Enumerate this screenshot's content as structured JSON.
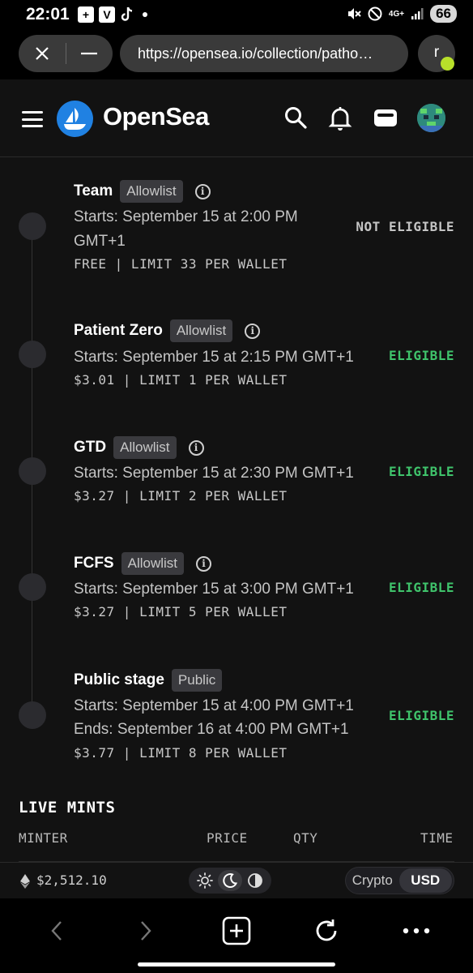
{
  "status_bar": {
    "time": "22:01",
    "network": "4G+",
    "battery": "66",
    "icons": [
      "plus-box-icon",
      "v-app-icon",
      "tiktok-icon",
      "notification-dot",
      "mute-icon",
      "dnd-icon",
      "signal-icon",
      "battery-icon"
    ]
  },
  "browser": {
    "url": "https://opensea.io/collection/patho…",
    "profile_initial": "r"
  },
  "header": {
    "brand": "OpenSea",
    "brand_color": "#2081e2"
  },
  "stages": [
    {
      "title": "Team",
      "badge": "Allowlist",
      "line1": "Starts: September 15 at 2:00 PM",
      "line2": "GMT+1",
      "meta": "FREE | LIMIT 33 PER WALLET",
      "status": "NOT ELIGIBLE"
    },
    {
      "title": "Patient Zero",
      "badge": "Allowlist",
      "line1": "Starts: September 15 at 2:15 PM GMT+1",
      "meta": "$3.01 | LIMIT 1 PER WALLET",
      "status": "ELIGIBLE"
    },
    {
      "title": "GTD",
      "badge": "Allowlist",
      "line1": "Starts: September 15 at 2:30 PM GMT+1",
      "meta": "$3.27 | LIMIT 2 PER WALLET",
      "status": "ELIGIBLE"
    },
    {
      "title": "FCFS",
      "badge": "Allowlist",
      "line1": "Starts: September 15 at 3:00 PM GMT+1",
      "meta": "$3.27 | LIMIT 5 PER WALLET",
      "status": "ELIGIBLE"
    },
    {
      "title": "Public stage",
      "badge": "Public",
      "line1": "Starts: September 15 at 4:00 PM GMT+1",
      "line2": "Ends: September 16 at 4:00 PM GMT+1",
      "meta": "$3.77 | LIMIT 8 PER WALLET",
      "status": "ELIGIBLE"
    }
  ],
  "live_mints": {
    "title": "LIVE MINTS",
    "columns": [
      "MINTER",
      "PRICE",
      "QTY",
      "TIME"
    ]
  },
  "footer": {
    "eth_price": "$2,512.10",
    "theme_options": [
      "sun-icon",
      "moon-icon",
      "contrast-icon"
    ],
    "currency_options": [
      "Crypto",
      "USD"
    ],
    "currency_selected": "USD"
  },
  "colors": {
    "eligible": "#3fc36b",
    "background": "#121212"
  }
}
